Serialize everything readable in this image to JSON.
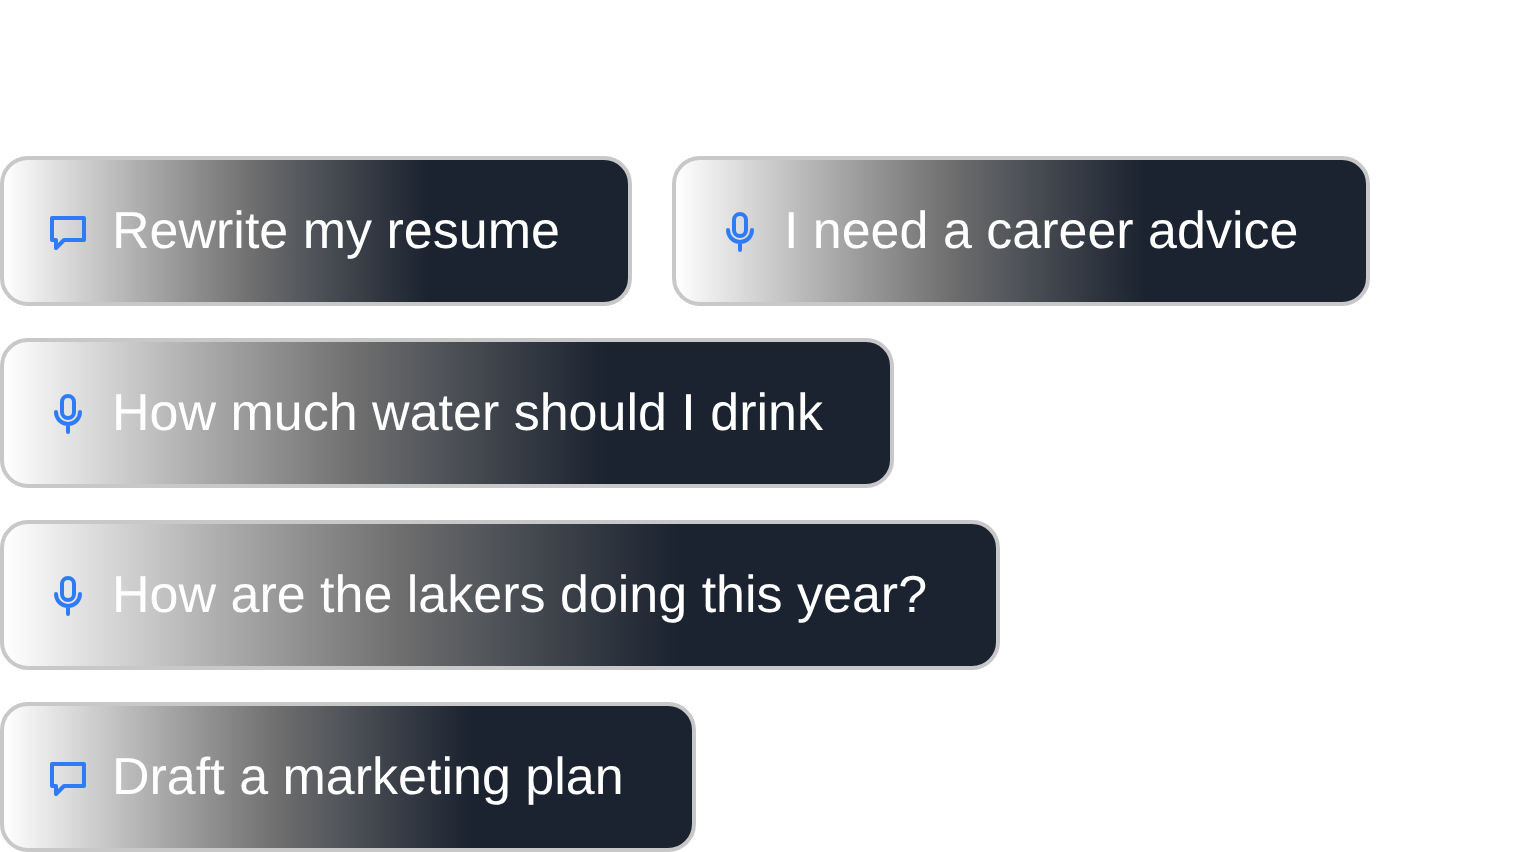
{
  "suggestion_rows": [
    {
      "chips": [
        {
          "kind": "chat",
          "label": "Rewrite my resume"
        },
        {
          "kind": "mic",
          "label": "I need a career advice"
        }
      ]
    },
    {
      "chips": [
        {
          "kind": "mic",
          "label": "How much water should I drink"
        }
      ]
    },
    {
      "chips": [
        {
          "kind": "mic",
          "label": "How are the lakers doing this year?"
        }
      ]
    },
    {
      "chips": [
        {
          "kind": "chat",
          "label": "Draft a marketing plan"
        }
      ]
    }
  ]
}
